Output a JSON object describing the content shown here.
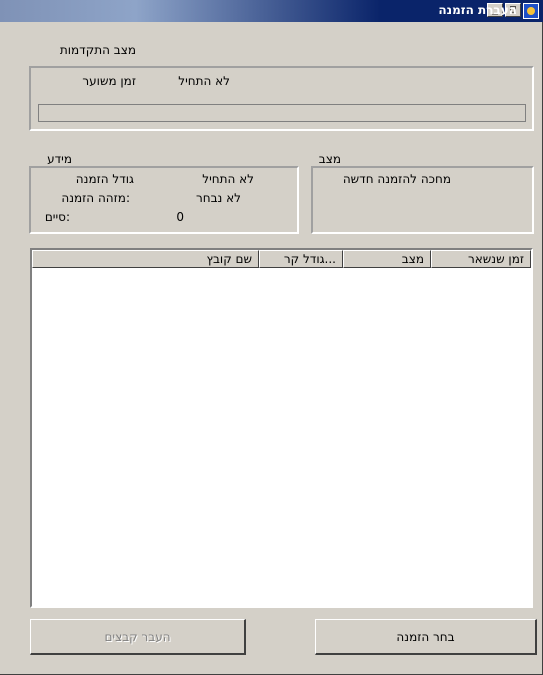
{
  "window": {
    "title": "העברת הזמנה",
    "controls": {
      "minimize": "_",
      "maximize": "□",
      "close": "×"
    }
  },
  "progress_section": {
    "heading": "מצב התקדמות",
    "estimated_time_label": "זמן משוער",
    "estimated_time_value": "לא התחיל",
    "progress_fraction": 0
  },
  "info_section": {
    "heading": "מידע",
    "rows": [
      {
        "label": "גודל הזמנה",
        "value": "לא התחיל"
      },
      {
        "label": ":מזהה הזמנה",
        "value": "לא נבחר"
      },
      {
        "label": ":סיים",
        "value": "0"
      }
    ]
  },
  "status_section": {
    "heading": "מצב",
    "text": "מחכה להזמנה חדשה"
  },
  "file_list": {
    "columns": [
      "שם קובץ",
      "...גודל קר",
      "מצב",
      "זמן שנשאר"
    ],
    "rows": []
  },
  "buttons": {
    "transfer_files": "העבר קבצים",
    "select_order": "בחר הזמנה"
  }
}
